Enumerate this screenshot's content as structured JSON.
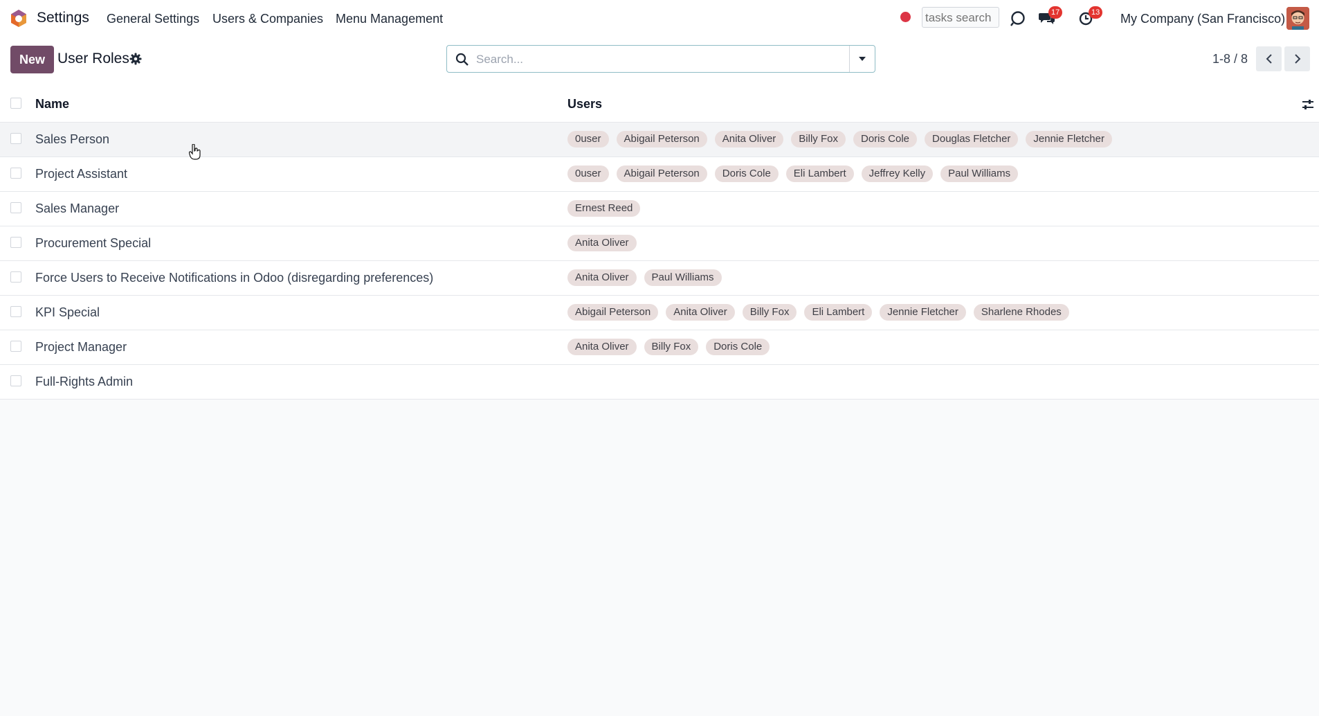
{
  "navbar": {
    "app_name": "Settings",
    "menu": [
      "General Settings",
      "Users & Companies",
      "Menu Management"
    ],
    "task_search_placeholder": "tasks search",
    "messages_badge": "17",
    "activities_badge": "13",
    "company": "My Company (San Francisco)",
    "icons": {
      "logo": "odoo-logo-icon",
      "debug": "bug-icon",
      "messages": "chat-bubbles-icon",
      "activities": "clock-icon"
    }
  },
  "control": {
    "new_label": "New",
    "title": "User Roles",
    "search_placeholder": "Search...",
    "pager": "1-8 / 8"
  },
  "list": {
    "columns": [
      "Name",
      "Users"
    ],
    "rows": [
      {
        "name": "Sales Person",
        "users": [
          "0user",
          "Abigail Peterson",
          "Anita Oliver",
          "Billy Fox",
          "Doris Cole",
          "Douglas Fletcher",
          "Jennie Fletcher"
        ]
      },
      {
        "name": "Project Assistant",
        "users": [
          "0user",
          "Abigail Peterson",
          "Doris Cole",
          "Eli Lambert",
          "Jeffrey Kelly",
          "Paul Williams"
        ]
      },
      {
        "name": "Sales Manager",
        "users": [
          "Ernest Reed"
        ]
      },
      {
        "name": "Procurement Special",
        "users": [
          "Anita Oliver"
        ]
      },
      {
        "name": "Force Users to Receive Notifications in Odoo (disregarding preferences)",
        "users": [
          "Anita Oliver",
          "Paul Williams"
        ]
      },
      {
        "name": "KPI Special",
        "users": [
          "Abigail Peterson",
          "Anita Oliver",
          "Billy Fox",
          "Eli Lambert",
          "Jennie Fletcher",
          "Sharlene Rhodes"
        ]
      },
      {
        "name": "Project Manager",
        "users": [
          "Anita Oliver",
          "Billy Fox",
          "Doris Cole"
        ]
      },
      {
        "name": "Full-Rights Admin",
        "users": []
      }
    ]
  },
  "colors": {
    "brand": "#714b67",
    "tag_bg": "#e9dedd",
    "badge": "#e3342f",
    "record": "#dc3545"
  }
}
